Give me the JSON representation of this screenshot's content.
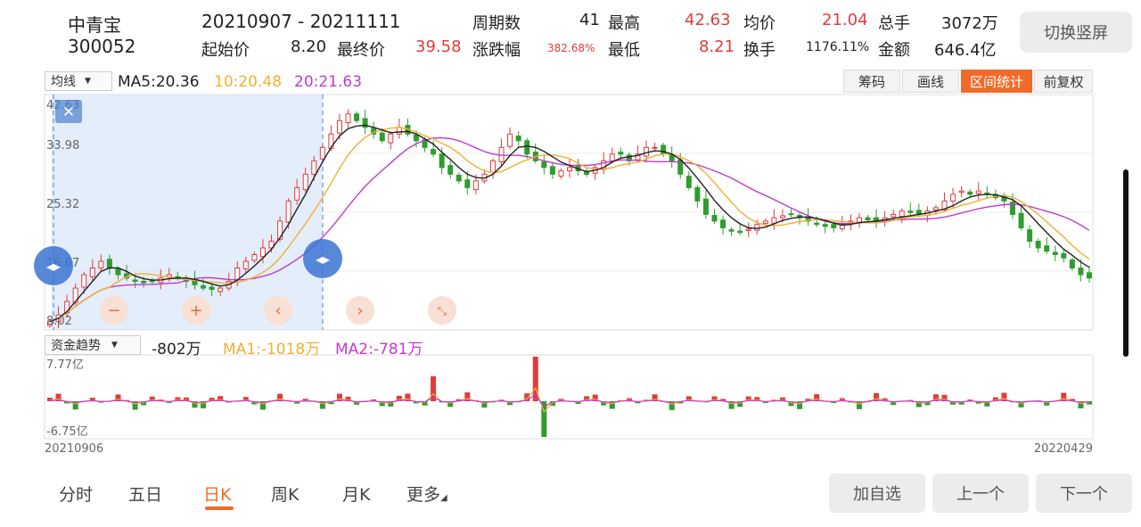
{
  "header": {
    "name": "中青宝",
    "code": "300052",
    "date_range": "20210907  - 20211111",
    "labels": {
      "periods": "周期数",
      "high": "最高",
      "avg": "均价",
      "total_hand": "总手",
      "start": "起始价",
      "end": "最终价",
      "change": "涨跌幅",
      "low": "最低",
      "turnover": "换手",
      "amount": "金额"
    },
    "values": {
      "periods": "41",
      "high": "42.63",
      "avg": "21.04",
      "total_hand": "3072万",
      "start": "8.20",
      "end": "39.58",
      "change": "382.68%",
      "low": "8.21",
      "turnover": "1176.11%",
      "amount": "646.4亿"
    }
  },
  "rotate_button": "切换竖屏",
  "top_buttons": [
    {
      "label": "筹码",
      "active": false
    },
    {
      "label": "画线",
      "active": false
    },
    {
      "label": "区间统计",
      "active": true
    },
    {
      "label": "前复权",
      "active": false
    }
  ],
  "ma_panel": {
    "selector": "均线",
    "ma5": "MA5:20.36",
    "ma10": "10:20.48",
    "ma20": "20:21.63"
  },
  "price_axis": [
    "42.63",
    "33.98",
    "25.32",
    "16.67",
    "8.02"
  ],
  "fund_panel": {
    "selector": "资金趋势",
    "value": "-802万",
    "ma1": "MA1:-1018万",
    "ma2": "MA2:-781万",
    "top": "7.77亿",
    "bottom": "-6.75亿"
  },
  "date_start": "20210906",
  "date_end": "20220429",
  "tabs": [
    {
      "label": "分时",
      "active": false
    },
    {
      "label": "五日",
      "active": false
    },
    {
      "label": "日K",
      "active": true
    },
    {
      "label": "周K",
      "active": false
    },
    {
      "label": "月K",
      "active": false
    },
    {
      "label": "更多",
      "active": false
    }
  ],
  "bottom_buttons": {
    "add": "加自选",
    "prev": "上一个",
    "next": "下一个"
  },
  "colors": {
    "up": "#e03c3c",
    "down": "#2e9d2e",
    "ma5": "#222222",
    "ma10": "#f0b030",
    "ma20": "#c03ccc",
    "accent": "#f06b2a"
  },
  "chart_data": {
    "type": "candlestick",
    "x_range": [
      "20210906",
      "20220429"
    ],
    "ylim": [
      8.02,
      42.63
    ],
    "selection": {
      "start": "20210907",
      "end": "20211111"
    },
    "close": [
      9,
      10,
      12,
      14,
      16,
      17,
      18,
      17,
      16,
      15.5,
      15,
      14.8,
      15,
      15.5,
      16,
      15.5,
      15,
      14.5,
      14,
      13.8,
      14,
      15,
      17,
      18,
      19,
      20,
      21,
      24,
      27,
      29,
      31,
      33,
      35,
      37,
      39,
      40,
      39,
      38,
      37,
      36,
      37,
      38,
      37,
      36,
      35,
      34,
      32,
      31,
      30,
      29,
      30,
      31,
      33,
      35,
      37,
      36,
      34,
      33,
      32,
      31,
      31.5,
      32,
      31.5,
      31,
      32,
      33,
      34,
      34,
      33,
      34,
      35,
      35,
      34,
      33,
      31,
      29,
      27,
      25,
      24,
      23,
      22.5,
      22.3,
      22.8,
      23.5,
      24,
      24.5,
      24.8,
      25,
      24.5,
      24,
      23.5,
      23.2,
      23,
      23.5,
      24,
      24.5,
      24.2,
      24,
      24.5,
      25,
      25.5,
      25.3,
      25,
      25.5,
      26,
      27,
      28,
      28.5,
      28,
      28.5,
      28,
      27.5,
      27,
      25,
      23,
      21,
      20,
      19.5,
      19,
      18.5,
      17,
      16,
      15.5
    ],
    "ma5": [
      9,
      9.5,
      10.5,
      12,
      13.5,
      15,
      16.5,
      17,
      17,
      16.5,
      15.8,
      15.4,
      15.2,
      15.2,
      15.4,
      15.5,
      15.5,
      15.3,
      15,
      14.6,
      14.3,
      14.5,
      15.2,
      16.2,
      17.3,
      18.5,
      19.8,
      21.5,
      23.5,
      25.8,
      28,
      30.5,
      32.8,
      35,
      36.7,
      37.8,
      38.2,
      38.3,
      38,
      37.6,
      37.2,
      37.3,
      37.4,
      37,
      36.3,
      35.5,
      34.3,
      33.2,
      32,
      31,
      30.5,
      30.4,
      31,
      32.2,
      33.8,
      35,
      35.2,
      35,
      34.4,
      33.6,
      32.8,
      32.3,
      31.8,
      31.4,
      31.6,
      32,
      32.8,
      33.4,
      33.6,
      33.8,
      34.2,
      34.5,
      34.4,
      34,
      33.2,
      31.9,
      30.4,
      28.8,
      27.1,
      25.7,
      24.5,
      23.6,
      23,
      22.9,
      23.1,
      23.6,
      24.1,
      24.4,
      24.6,
      24.6,
      24.4,
      24.1,
      23.7,
      23.4,
      23.5,
      23.8,
      23.9,
      24,
      24.2,
      24.4,
      24.6,
      24.8,
      25,
      25.2,
      25.5,
      25.8,
      26.3,
      27,
      27.6,
      27.9,
      28,
      27.9,
      27.6,
      27.2,
      26.3,
      25,
      23.6,
      22.3,
      21,
      19.8,
      18.9,
      17.9,
      17.1
    ]
  }
}
